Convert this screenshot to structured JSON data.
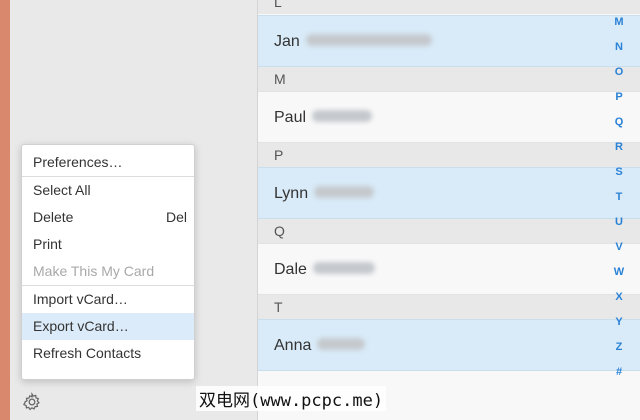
{
  "menu": {
    "items": [
      {
        "label": "Preferences…"
      },
      {
        "label": "Select All"
      },
      {
        "label": "Delete",
        "shortcut": "Del"
      },
      {
        "label": "Print"
      },
      {
        "label": "Make This My Card"
      },
      {
        "label": "Import vCard…"
      },
      {
        "label": "Export vCard…"
      },
      {
        "label": "Refresh Contacts"
      }
    ]
  },
  "contacts": {
    "sections": [
      {
        "letter": "L",
        "name": "Jan"
      },
      {
        "letter": "M",
        "name": "Paul"
      },
      {
        "letter": "P",
        "name": "Lynn"
      },
      {
        "letter": "Q",
        "name": "Dale"
      },
      {
        "letter": "T",
        "name": "Anna"
      }
    ]
  },
  "alphabet_index": [
    "M",
    "N",
    "O",
    "P",
    "Q",
    "R",
    "S",
    "T",
    "U",
    "V",
    "W",
    "X",
    "Y",
    "Z",
    "#"
  ],
  "watermark": "双电网(www.pcpc.me)",
  "icons": {
    "settings": "gear-icon"
  },
  "colors": {
    "accent": "#d9876d",
    "selection": "#d9ebf8",
    "index": "#2a82d6"
  }
}
